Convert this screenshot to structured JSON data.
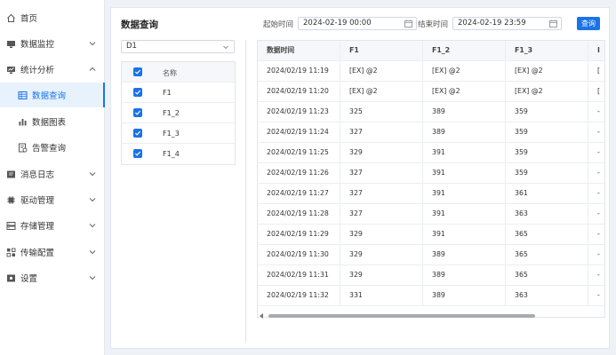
{
  "sidebar": {
    "items": [
      {
        "label": "首页",
        "icon": "home-icon"
      },
      {
        "label": "数据监控",
        "icon": "monitor-icon",
        "chevron": "down"
      },
      {
        "label": "统计分析",
        "icon": "chart-icon",
        "chevron": "up"
      },
      {
        "label": "数据查询",
        "icon": "table-icon",
        "active": true
      },
      {
        "label": "数据图表",
        "icon": "bar-chart-icon"
      },
      {
        "label": "告警查询",
        "icon": "alarm-icon"
      },
      {
        "label": "消息日志",
        "icon": "message-icon",
        "chevron": "down"
      },
      {
        "label": "驱动管理",
        "icon": "chip-icon",
        "chevron": "down"
      },
      {
        "label": "存储管理",
        "icon": "storage-icon",
        "chevron": "down"
      },
      {
        "label": "传输配置",
        "icon": "transfer-icon",
        "chevron": "down"
      },
      {
        "label": "设置",
        "icon": "settings-icon",
        "chevron": "down"
      }
    ]
  },
  "main": {
    "title": "数据查询",
    "start_label": "起始时间",
    "start_value": "2024-02-19 00:00",
    "end_label": "结束时间",
    "end_value": "2024-02-19 23:59",
    "query_button": "查询",
    "device_select": "D1"
  },
  "field_list": {
    "header": "名称",
    "items": [
      "F1",
      "F1_2",
      "F1_3",
      "F1_4"
    ]
  },
  "table": {
    "columns": [
      "数据时间",
      "F1",
      "F1_2",
      "F1_3",
      "I"
    ],
    "rows": [
      [
        "2024/02/19 11:19",
        "[EX] @2",
        "[EX] @2",
        "[EX] @2",
        "["
      ],
      [
        "2024/02/19 11:20",
        "[EX] @2",
        "[EX] @2",
        "[EX] @2",
        "["
      ],
      [
        "2024/02/19 11:23",
        "325",
        "389",
        "359",
        "-"
      ],
      [
        "2024/02/19 11:24",
        "327",
        "389",
        "359",
        "-"
      ],
      [
        "2024/02/19 11:25",
        "329",
        "391",
        "359",
        "-"
      ],
      [
        "2024/02/19 11:26",
        "327",
        "391",
        "359",
        "-"
      ],
      [
        "2024/02/19 11:27",
        "327",
        "391",
        "361",
        "-"
      ],
      [
        "2024/02/19 11:28",
        "327",
        "391",
        "363",
        "-"
      ],
      [
        "2024/02/19 11:29",
        "329",
        "391",
        "365",
        "-"
      ],
      [
        "2024/02/19 11:30",
        "329",
        "389",
        "365",
        "-"
      ],
      [
        "2024/02/19 11:31",
        "329",
        "389",
        "365",
        "-"
      ],
      [
        "2024/02/19 11:32",
        "331",
        "389",
        "363",
        "-"
      ]
    ]
  },
  "colors": {
    "accent": "#1a73e8",
    "active_bg": "#e8f2fd"
  }
}
